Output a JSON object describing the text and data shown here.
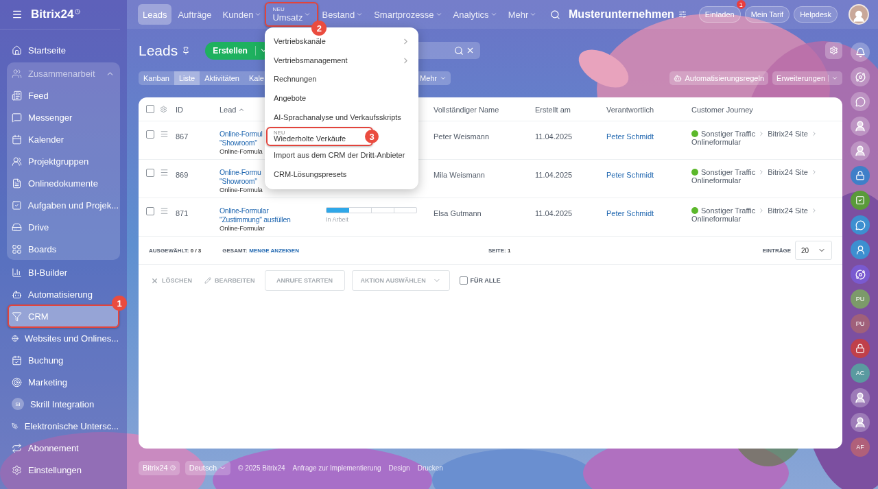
{
  "sidebar": {
    "brand": "Bitrix24",
    "items": [
      {
        "kind": "link",
        "label": "Startseite",
        "selected": false
      },
      {
        "kind": "group",
        "label": "Zusammenarbeit",
        "expanded": true,
        "children": [
          {
            "label": "Feed",
            "selected": false
          },
          {
            "label": "Messenger",
            "selected": false
          },
          {
            "label": "Kalender",
            "selected": false
          },
          {
            "label": "Projektgruppen",
            "selected": false
          },
          {
            "label": "Onlinedokumente",
            "selected": false
          },
          {
            "label": "Aufgaben und Projek...",
            "selected": false
          },
          {
            "label": "Drive",
            "selected": false
          },
          {
            "label": "Boards",
            "selected": false
          }
        ]
      },
      {
        "kind": "link",
        "label": "BI-Builder",
        "selected": false
      },
      {
        "kind": "link",
        "label": "Automatisierung",
        "selected": false
      },
      {
        "kind": "link",
        "label": "CRM",
        "selected": true,
        "callout": "1"
      },
      {
        "kind": "link",
        "label": "Websites und Onlines...",
        "selected": false
      },
      {
        "kind": "link",
        "label": "Buchung",
        "selected": false
      },
      {
        "kind": "link",
        "label": "Marketing",
        "selected": false
      },
      {
        "kind": "link",
        "label": "Skrill Integration",
        "selected": false,
        "initials": "SI"
      },
      {
        "kind": "link",
        "label": "Elektronische Untersc...",
        "selected": false
      },
      {
        "kind": "link",
        "label": "Abonnement",
        "selected": false
      },
      {
        "kind": "link",
        "label": "Einstellungen",
        "selected": false
      }
    ]
  },
  "topbar": {
    "nav": [
      {
        "label": "Leads",
        "selected": true,
        "dropdown": false
      },
      {
        "label": "Aufträge",
        "selected": false,
        "dropdown": false
      },
      {
        "label": "Kunden",
        "selected": false,
        "dropdown": true
      },
      {
        "label": "Umsatz",
        "selected": false,
        "dropdown": true,
        "tag": "NEU",
        "callout": "2"
      },
      {
        "label": "Bestand",
        "selected": false,
        "dropdown": true
      },
      {
        "label": "Smartprozesse",
        "selected": false,
        "dropdown": true
      },
      {
        "label": "Analytics",
        "selected": false,
        "dropdown": true
      },
      {
        "label": "Mehr",
        "selected": false,
        "dropdown": true
      }
    ],
    "company": "Musterunternehmen",
    "buttons": [
      {
        "label": "Einladen",
        "badge": "1"
      },
      {
        "label": "Mein Tarif"
      },
      {
        "label": "Helpdesk"
      }
    ]
  },
  "page": {
    "title": "Leads",
    "create_button": "Erstellen",
    "views": [
      {
        "label": "Kanban",
        "selected": false
      },
      {
        "label": "Liste",
        "selected": true
      },
      {
        "label": "Aktivitäten",
        "selected": false
      },
      {
        "label": "Kale",
        "selected": false
      }
    ],
    "more_button": "Mehr",
    "automation_button": "Automatisierungsregeln",
    "extensions_button": "Erweiterungen"
  },
  "menu": {
    "items": [
      {
        "label": "Vertriebskanäle",
        "submenu": true
      },
      {
        "label": "Vertriebsmanagement",
        "submenu": true
      },
      {
        "label": "Rechnungen",
        "submenu": false
      },
      {
        "label": "Angebote",
        "submenu": false
      },
      {
        "label": "AI-Sprachanalyse und Verkaufsskripts",
        "submenu": false
      },
      {
        "label": "Wiederholte Verkäufe",
        "submenu": false,
        "tag": "NEU",
        "callout": "3"
      },
      {
        "label": "Import aus dem CRM der Dritt-Anbieter",
        "submenu": false
      },
      {
        "label": "CRM-Lösungspresets",
        "submenu": false
      }
    ]
  },
  "table": {
    "all_checked": false,
    "columns": [
      {
        "label": "ID",
        "sorted": false
      },
      {
        "label": "Lead",
        "sorted": true
      },
      {
        "label": "Vollständiger Name",
        "sorted": false
      },
      {
        "label": "Erstellt am",
        "sorted": false
      },
      {
        "label": "Verantwortlich",
        "sorted": false
      },
      {
        "label": "Customer Journey",
        "sorted": false
      }
    ],
    "rows": [
      {
        "checked": false,
        "id": "867",
        "lead_lines": [
          "Online-Formul",
          "\"Showroom\""
        ],
        "source": "Online-Formula",
        "name": "Peter Weismann",
        "created": "11.04.2025",
        "owner": "Peter Schmidt",
        "journey": {
          "color": "#5cb82c",
          "steps": [
            "Sonstiger Traffic",
            "Bitrix24 Site",
            "Onlineformular"
          ]
        }
      },
      {
        "checked": false,
        "id": "869",
        "lead_lines": [
          "Online-Formu",
          "\"Showroom\""
        ],
        "source": "Online-Formula",
        "name": "Mila Weismann",
        "created": "11.04.2025",
        "owner": "Peter Schmidt",
        "journey": {
          "color": "#5cb82c",
          "steps": [
            "Sonstiger Traffic",
            "Bitrix24 Site",
            "Onlineformular"
          ]
        }
      },
      {
        "checked": false,
        "id": "871",
        "lead_lines": [
          "Online-Formular",
          "\"Zustimmung\" ausfüllen"
        ],
        "source": "Online-Formular",
        "stage": {
          "level": 0.25,
          "label": "In Arbeit"
        },
        "name": "Elsa Gutmann",
        "created": "11.04.2025",
        "owner": "Peter Schmidt",
        "journey": {
          "color": "#5cb82c",
          "steps": [
            "Sonstiger Traffic",
            "Bitrix24 Site",
            "Onlineformular"
          ]
        }
      }
    ],
    "summary": {
      "selected": "AUSGEWÄHLT: **0 / 3**",
      "total_label": "GESAMT:",
      "total_link": "MENGE ANZEIGEN",
      "page": "SEITE: **1**",
      "per_page_label": "EINTRÄGE",
      "per_page": "20"
    },
    "actions": [
      {
        "kind": "delete",
        "label": "LÖSCHEN",
        "disabled": true
      },
      {
        "kind": "edit",
        "label": "BEARBEITEN",
        "disabled": true
      },
      {
        "kind": "button",
        "label": "ANRUFE STARTEN",
        "disabled": true
      },
      {
        "kind": "select",
        "label": "AKTION AUSWÄHLEN",
        "disabled": true
      },
      {
        "kind": "checkbox",
        "label": "FÜR ALLE",
        "checked": false
      }
    ]
  },
  "footer": {
    "brand": "Bitrix24",
    "language": "Deutsch",
    "links": [
      "© 2025 Bitrix24",
      "Anfrage zur Implementierung",
      "Design",
      "Drucken"
    ]
  },
  "right_rail": [
    {
      "kind": "bell"
    },
    {
      "kind": "copilot"
    },
    {
      "kind": "chat"
    },
    {
      "kind": "avatar"
    },
    {
      "kind": "avatar"
    },
    {
      "kind": "lock",
      "color": "#3f7fc8"
    },
    {
      "kind": "task",
      "color": "#5a9a3a"
    },
    {
      "kind": "chat",
      "color": "#3d8fd0"
    },
    {
      "kind": "contact",
      "color": "#3d8fd0"
    },
    {
      "kind": "copilot",
      "color": "#7a5ad0"
    },
    {
      "kind": "initials",
      "text": "PU",
      "color": "#7c9a6a"
    },
    {
      "kind": "initials",
      "text": "PU",
      "color": "#a0607a"
    },
    {
      "kind": "lock",
      "color": "#c0404a"
    },
    {
      "kind": "initials",
      "text": "AC",
      "color": "#5a9aa0"
    },
    {
      "kind": "avatar"
    },
    {
      "kind": "avatar"
    },
    {
      "kind": "initials",
      "text": "AF",
      "color": "#b0607a"
    }
  ]
}
